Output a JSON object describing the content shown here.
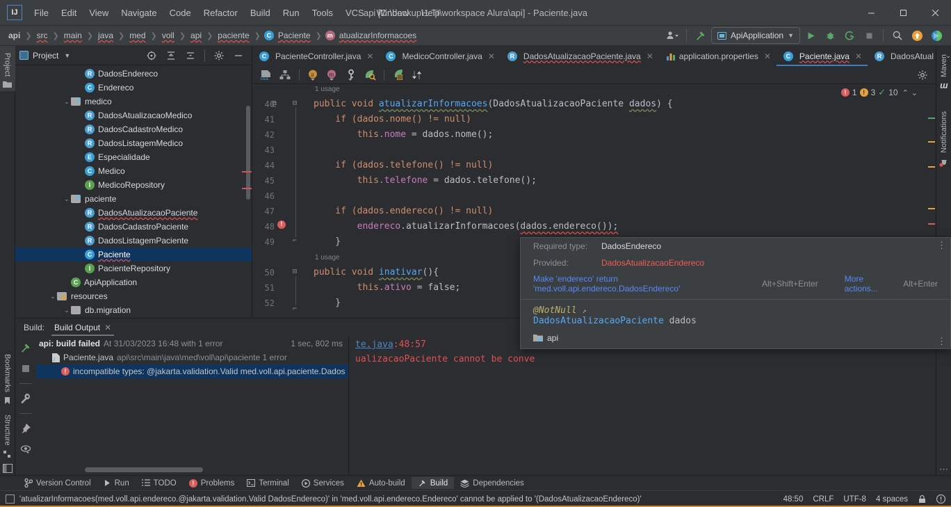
{
  "window": {
    "title": "api [D:\\backup\\1 TI\\workspace Alura\\api] - Paciente.java",
    "logo": "IJ",
    "minimize": "–",
    "maximize": "▢",
    "close": "✕"
  },
  "menu": [
    "File",
    "Edit",
    "View",
    "Navigate",
    "Code",
    "Refactor",
    "Build",
    "Run",
    "Tools",
    "VCS",
    "Window",
    "Help"
  ],
  "breadcrumb": [
    {
      "label": "api",
      "icon": null,
      "bold": true
    },
    {
      "label": "src",
      "icon": null,
      "bold": false
    },
    {
      "label": "main",
      "icon": null,
      "bold": false
    },
    {
      "label": "java",
      "icon": null,
      "bold": false
    },
    {
      "label": "med",
      "icon": null,
      "bold": false
    },
    {
      "label": "voll",
      "icon": null,
      "bold": false
    },
    {
      "label": "api",
      "icon": null,
      "bold": false
    },
    {
      "label": "paciente",
      "icon": null,
      "bold": false
    },
    {
      "label": "Paciente",
      "icon": "C",
      "bold": false
    },
    {
      "label": "atualizarInformacoes",
      "icon": "m",
      "bold": false
    }
  ],
  "toolbar": {
    "run_config": "ApiApplication",
    "run_label": "Run",
    "debug_label": "Debug",
    "coverage_label": "Run with Coverage",
    "stop_label": "Stop",
    "search_label": "Search Everywhere",
    "updates_label": "Updates",
    "ai_label": "AI Assistant",
    "settings_label": "Settings"
  },
  "left_strip": {
    "project": "Project",
    "bookmarks": "Bookmarks",
    "structure": "Structure"
  },
  "right_strip": {
    "maven": "Maven",
    "notifications": "Notifications"
  },
  "project_panel": {
    "title": "Project",
    "tree": [
      {
        "label": "DadosEndereco",
        "icon": "R",
        "indent": 4,
        "chev": "",
        "type": "file"
      },
      {
        "label": "Endereco",
        "icon": "C",
        "indent": 4,
        "chev": "",
        "type": "file"
      },
      {
        "label": "medico",
        "icon": "folder",
        "indent": 3,
        "chev": "v",
        "type": "folder"
      },
      {
        "label": "DadosAtualizacaoMedico",
        "icon": "R",
        "indent": 4,
        "chev": "",
        "type": "file"
      },
      {
        "label": "DadosCadastroMedico",
        "icon": "R",
        "indent": 4,
        "chev": "",
        "type": "file"
      },
      {
        "label": "DadosListagemMedico",
        "icon": "R",
        "indent": 4,
        "chev": "",
        "type": "file"
      },
      {
        "label": "Especialidade",
        "icon": "E",
        "indent": 4,
        "chev": "",
        "type": "file"
      },
      {
        "label": "Medico",
        "icon": "C",
        "indent": 4,
        "chev": "",
        "type": "file"
      },
      {
        "label": "MedicoRepository",
        "icon": "I",
        "indent": 4,
        "chev": "",
        "type": "file"
      },
      {
        "label": "paciente",
        "icon": "folder",
        "indent": 3,
        "chev": "v",
        "type": "folder"
      },
      {
        "label": "DadosAtualizacaoPaciente",
        "icon": "R",
        "indent": 4,
        "chev": "",
        "type": "file",
        "squiggle": true
      },
      {
        "label": "DadosCadastroPaciente",
        "icon": "R",
        "indent": 4,
        "chev": "",
        "type": "file"
      },
      {
        "label": "DadosListagemPaciente",
        "icon": "R",
        "indent": 4,
        "chev": "",
        "type": "file"
      },
      {
        "label": "Paciente",
        "icon": "C",
        "indent": 4,
        "chev": "",
        "type": "file",
        "selected": true,
        "squiggle": true
      },
      {
        "label": "PacienteRepository",
        "icon": "I",
        "indent": 4,
        "chev": "",
        "type": "file"
      },
      {
        "label": "ApiApplication",
        "icon": "CRun",
        "indent": 3,
        "chev": "",
        "type": "file"
      },
      {
        "label": "resources",
        "icon": "folderRes",
        "indent": 2,
        "chev": "v",
        "type": "folder"
      },
      {
        "label": "db.migration",
        "icon": "folderPlain",
        "indent": 3,
        "chev": "v",
        "type": "folder"
      }
    ]
  },
  "editor": {
    "tabs": [
      {
        "label": "PacienteController.java",
        "icon": "C",
        "active": false,
        "closable": true
      },
      {
        "label": "MedicoController.java",
        "icon": "C",
        "active": false,
        "closable": true
      },
      {
        "label": "DadosAtualizacaoPaciente.java",
        "icon": "R",
        "active": false,
        "closable": true,
        "squiggle": true
      },
      {
        "label": "application.properties",
        "icon": "P",
        "active": false,
        "closable": true
      },
      {
        "label": "Paciente.java",
        "icon": "C",
        "active": true,
        "closable": true,
        "squiggle": true
      },
      {
        "label": "DadosAtual",
        "icon": "R",
        "active": false,
        "closable": false
      }
    ],
    "inspection": {
      "errors": "1",
      "warnings": "3",
      "checks": "10"
    },
    "lines": [
      {
        "num": "40",
        "marker": "@",
        "fold": "collapse",
        "usage": "1 usage"
      },
      {
        "num": "41"
      },
      {
        "num": "42"
      },
      {
        "num": "43"
      },
      {
        "num": "44"
      },
      {
        "num": "45"
      },
      {
        "num": "46"
      },
      {
        "num": "47"
      },
      {
        "num": "48",
        "error": true
      },
      {
        "num": "49",
        "fold": "end"
      },
      {
        "num": "50",
        "fold": "collapse",
        "usage": "1 usage"
      },
      {
        "num": "51"
      },
      {
        "num": "52",
        "fold": "end"
      }
    ],
    "code": {
      "l40a": "public void ",
      "l40b": "atualizarInformacoes",
      "l40c": "(DadosAtualizacaoPaciente ",
      "l40d": "dados",
      "l40e": ") {",
      "l41": "    if (dados.nome() != null)",
      "l42a": "        this",
      "l42b": ".nome",
      "l42c": " = dados.nome();",
      "l44": "    if (dados.telefone() != null)",
      "l45a": "        this",
      "l45b": ".telefone",
      "l45c": " = dados.telefone();",
      "l47": "    if (dados.endereco() != null)",
      "l48a": "        endereco",
      "l48b": ".atualizarInformacoes(",
      "l48c": "dados.endereco()",
      "l48d": ");",
      "l49": "    }",
      "l50a": "public void ",
      "l50b": "inativar",
      "l50c": "(){",
      "l51a": "        this",
      "l51b": ".ativo",
      "l51c": " = false;",
      "l52": "    }"
    }
  },
  "popup": {
    "required_label": "Required type:",
    "required_value": "DadosEndereco",
    "provided_label": "Provided:",
    "provided_value": "DadosAtualizacaoEndereco",
    "action_link": "Make 'endereco' return 'med.voll.api.endereco.DadosEndereco'",
    "action_shortcut": "Alt+Shift+Enter",
    "more_actions": "More actions...",
    "more_shortcut": "Alt+Enter",
    "annotation": "@NotNull",
    "param_type": "DadosAtualizacaoPaciente",
    "param_name": "dados",
    "footer": "api"
  },
  "build": {
    "label": "Build:",
    "tab": "Build Output",
    "rows": [
      {
        "title": "api: build failed",
        "detail": "At 31/03/2023 16:48 with 1 error",
        "time": "1 sec, 802 ms",
        "kind": "root"
      },
      {
        "title": "Paciente.java",
        "detail": "api\\src\\main\\java\\med\\voll\\api\\paciente 1 error",
        "kind": "file"
      },
      {
        "title": "incompatible types: @jakarta.validation.Valid med.voll.api.paciente.Dados",
        "kind": "error",
        "selected": true
      }
    ],
    "console": {
      "file_link": "te.java",
      "position": ":48:57",
      "message": "ualizacaoPaciente cannot be conve"
    }
  },
  "tool_windows": [
    {
      "label": "Version Control",
      "icon": "branch-icon",
      "active": false
    },
    {
      "label": "Run",
      "icon": "play-icon",
      "active": false
    },
    {
      "label": "TODO",
      "icon": "list-icon",
      "active": false
    },
    {
      "label": "Problems",
      "icon": "error-icon",
      "active": false
    },
    {
      "label": "Terminal",
      "icon": "terminal-icon",
      "active": false
    },
    {
      "label": "Services",
      "icon": "services-icon",
      "active": false
    },
    {
      "label": "Auto-build",
      "icon": "warning-icon",
      "active": false
    },
    {
      "label": "Build",
      "icon": "hammer-icon",
      "active": true
    },
    {
      "label": "Dependencies",
      "icon": "layers-icon",
      "active": false
    }
  ],
  "statusbar": {
    "message": "'atualizarInformacoes(med.voll.api.endereco.@jakarta.validation.Valid DadosEndereco)' in 'med.voll.api.endereco.Endereco' cannot be applied to '(DadosAtualizacaoEndereco)'",
    "caret": "48:50",
    "line_sep": "CRLF",
    "encoding": "UTF-8",
    "indent": "4 spaces"
  },
  "colors": {
    "accent": "#3d7fc1",
    "error": "#e05252",
    "warning": "#d9a441",
    "selection": "#0f355e",
    "bg": "#2b2d30",
    "panel": "#3c3f41"
  }
}
